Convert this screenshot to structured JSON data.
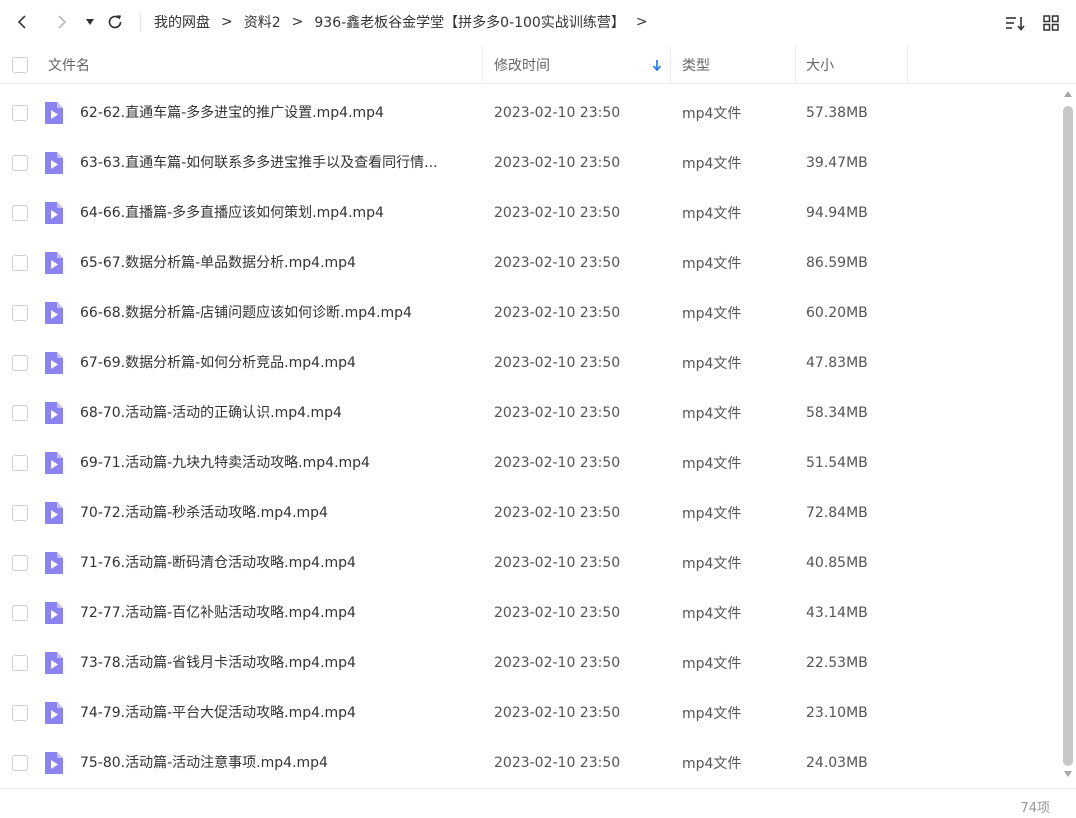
{
  "toolbar": {
    "breadcrumb": [
      "我的网盘",
      "资料2",
      "936-鑫老板谷金学堂【拼多多0-100实战训练营】"
    ],
    "separator": ">",
    "icons": [
      "back-icon",
      "forward-icon",
      "dropdown-icon",
      "refresh-icon",
      "sort-list-icon",
      "grid-view-icon"
    ]
  },
  "header": {
    "name": "文件名",
    "modified": "修改时间",
    "type": "类型",
    "size": "大小"
  },
  "colors": {
    "accent": "#1a73e8",
    "file_icon": "#8b83f0"
  },
  "files": [
    {
      "name": "62-62.直通车篇-多多进宝的推广设置.mp4.mp4",
      "date": "2023-02-10 23:50",
      "type": "mp4文件",
      "size": "57.38MB"
    },
    {
      "name": "63-63.直通车篇-如何联系多多进宝推手以及查看同行情...",
      "date": "2023-02-10 23:50",
      "type": "mp4文件",
      "size": "39.47MB"
    },
    {
      "name": "64-66.直播篇-多多直播应该如何策划.mp4.mp4",
      "date": "2023-02-10 23:50",
      "type": "mp4文件",
      "size": "94.94MB"
    },
    {
      "name": "65-67.数据分析篇-单品数据分析.mp4.mp4",
      "date": "2023-02-10 23:50",
      "type": "mp4文件",
      "size": "86.59MB"
    },
    {
      "name": "66-68.数据分析篇-店铺问题应该如何诊断.mp4.mp4",
      "date": "2023-02-10 23:50",
      "type": "mp4文件",
      "size": "60.20MB"
    },
    {
      "name": "67-69.数据分析篇-如何分析竞品.mp4.mp4",
      "date": "2023-02-10 23:50",
      "type": "mp4文件",
      "size": "47.83MB"
    },
    {
      "name": "68-70.活动篇-活动的正确认识.mp4.mp4",
      "date": "2023-02-10 23:50",
      "type": "mp4文件",
      "size": "58.34MB"
    },
    {
      "name": "69-71.活动篇-九块九特卖活动攻略.mp4.mp4",
      "date": "2023-02-10 23:50",
      "type": "mp4文件",
      "size": "51.54MB"
    },
    {
      "name": "70-72.活动篇-秒杀活动攻略.mp4.mp4",
      "date": "2023-02-10 23:50",
      "type": "mp4文件",
      "size": "72.84MB"
    },
    {
      "name": "71-76.活动篇-断码清仓活动攻略.mp4.mp4",
      "date": "2023-02-10 23:50",
      "type": "mp4文件",
      "size": "40.85MB"
    },
    {
      "name": "72-77.活动篇-百亿补贴活动攻略.mp4.mp4",
      "date": "2023-02-10 23:50",
      "type": "mp4文件",
      "size": "43.14MB"
    },
    {
      "name": "73-78.活动篇-省钱月卡活动攻略.mp4.mp4",
      "date": "2023-02-10 23:50",
      "type": "mp4文件",
      "size": "22.53MB"
    },
    {
      "name": "74-79.活动篇-平台大促活动攻略.mp4.mp4",
      "date": "2023-02-10 23:50",
      "type": "mp4文件",
      "size": "23.10MB"
    },
    {
      "name": "75-80.活动篇-活动注意事项.mp4.mp4",
      "date": "2023-02-10 23:50",
      "type": "mp4文件",
      "size": "24.03MB"
    }
  ],
  "footer": {
    "count": "74项"
  }
}
